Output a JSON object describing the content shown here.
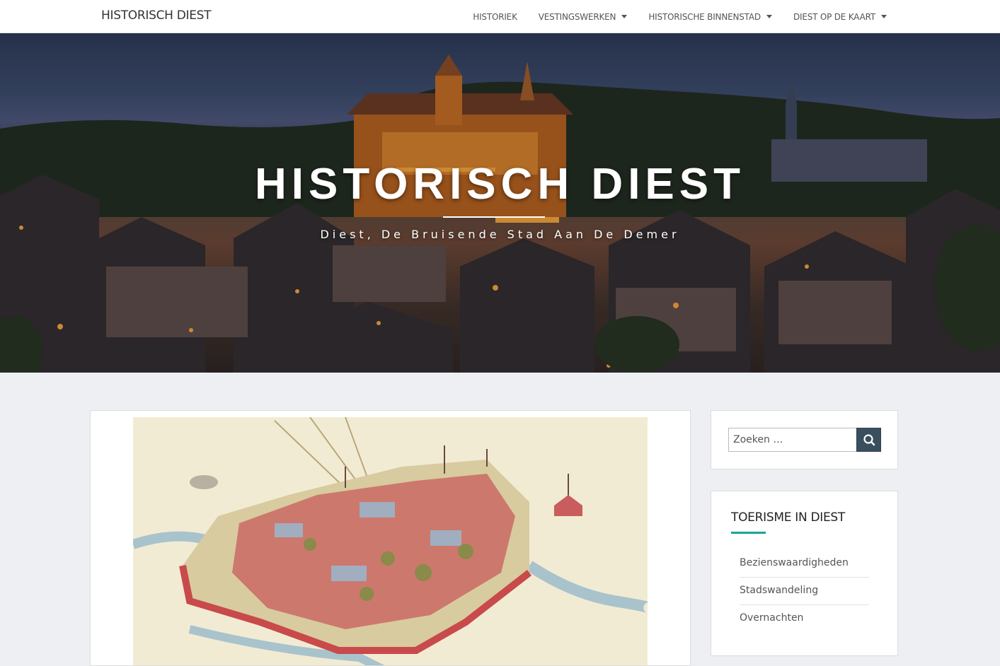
{
  "header": {
    "brand": "HISTORISCH DIEST",
    "nav": [
      {
        "label": "HISTORIEK",
        "dropdown": false
      },
      {
        "label": "VESTINGSWERKEN",
        "dropdown": true
      },
      {
        "label": "HISTORISCHE BINNENSTAD",
        "dropdown": true
      },
      {
        "label": "DIEST OP DE KAART",
        "dropdown": true
      }
    ]
  },
  "hero": {
    "title": "HISTORISCH DIEST",
    "subtitle": "Diest, De Bruisende Stad Aan De Demer"
  },
  "sidebar": {
    "search": {
      "placeholder": "Zoeken …",
      "button_icon": "search-icon"
    },
    "toerisme": {
      "title": "TOERISME IN DIEST",
      "items": [
        "Bezienswaardigheden",
        "Stadswandeling",
        "Overnachten"
      ]
    }
  },
  "colors": {
    "accent": "#17a39b",
    "search_button": "#3a4f5e",
    "background": "#edeff2"
  }
}
